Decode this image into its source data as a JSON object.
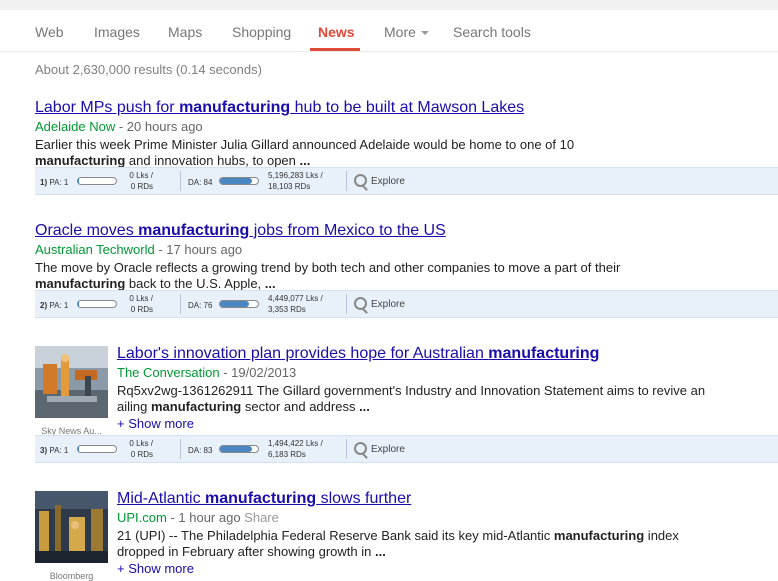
{
  "nav": {
    "tabs": [
      {
        "label": "Web"
      },
      {
        "label": "Images"
      },
      {
        "label": "Maps"
      },
      {
        "label": "Shopping"
      },
      {
        "label": "News",
        "active": true
      },
      {
        "label": "More"
      },
      {
        "label": "Search tools"
      }
    ]
  },
  "stats": "About 2,630,000 results (0.14 seconds)",
  "results": [
    {
      "title_pre": "Labor MPs push for ",
      "title_bold": "manufacturing",
      "title_post": " hub to be built at Mawson Lakes",
      "source": "Adelaide Now",
      "time": " - 20 hours ago",
      "snip1": "Earlier this week Prime Minister Julia Gillard announced Adelaide would be home to one of 10",
      "snip2_bold": "manufacturing",
      "snip2": " and innovation hubs, to open ",
      "snip2_end": "...",
      "moz": {
        "rank": "1)",
        "pa": "PA: 1",
        "lks": "0 Lks /",
        "rds": "0 RDs",
        "da": "DA: 84",
        "da_value": 84,
        "dlks": "5,196,283 Lks /",
        "drds": "18,103 RDs",
        "explore": "Explore"
      }
    },
    {
      "title_pre": "Oracle moves ",
      "title_bold": "manufacturing",
      "title_post": " jobs from Mexico to the US",
      "source": "Australian Techworld",
      "time": " - 17 hours ago",
      "snip1": "The move by Oracle reflects a growing trend by both tech and other companies to move a part of their",
      "snip2_bold": "manufacturing",
      "snip2": " back to the U.S. Apple, ",
      "snip2_end": "...",
      "moz": {
        "rank": "2)",
        "pa": "PA: 1",
        "lks": "0 Lks /",
        "rds": "0 RDs",
        "da": "DA: 76",
        "da_value": 76,
        "dlks": "4,449,077 Lks /",
        "drds": "3,353 RDs",
        "explore": "Explore"
      }
    },
    {
      "title_pre": "Labor's innovation plan provides hope for Australian ",
      "title_bold": "manufacturing",
      "title_post": "",
      "source": "The Conversation",
      "time": " - 19/02/2013",
      "snip1": "Rq5xv2wg-1361262911 The Gillard government's Industry and Innovation Statement aims to revive an",
      "snip2_pre": "ailing ",
      "snip2_bold": "manufacturing",
      "snip2": " sector and address ",
      "snip2_end": "...",
      "showmore": "+ Show more",
      "thumb_caption": "Sky News Au...",
      "moz": {
        "rank": "3)",
        "pa": "PA: 1",
        "lks": "0 Lks /",
        "rds": "0 RDs",
        "da": "DA: 83",
        "da_value": 83,
        "dlks": "1,494,422 Lks /",
        "drds": "6,183 RDs",
        "explore": "Explore"
      }
    },
    {
      "title_pre": "Mid-Atlantic ",
      "title_bold": "manufacturing",
      "title_post": " slows further",
      "source": "UPI.com",
      "time": " - 1 hour ago",
      "share": " Share",
      "snip1_pre": "21 (UPI) -- The Philadelphia Federal Reserve Bank said its key mid-Atlantic ",
      "snip1_bold": "manufacturing",
      "snip1_post": " index",
      "snip2": "dropped in February after showing growth in ",
      "snip2_end": "...",
      "showmore": "+ Show more",
      "thumb_caption": "Bloomberg"
    }
  ],
  "colors": {
    "accent": "#dd4b39",
    "link": "#1a0dab",
    "source": "#009933"
  }
}
